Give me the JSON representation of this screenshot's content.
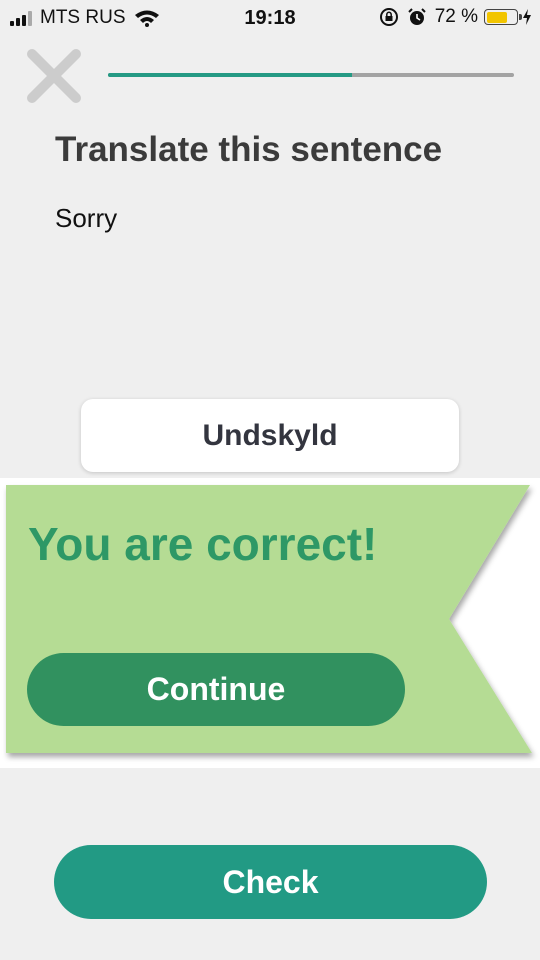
{
  "status_bar": {
    "carrier": "MTS RUS",
    "time": "19:18",
    "battery_percent": "72 %",
    "battery_level": 0.72,
    "icons": [
      "signal-icon",
      "wifi-icon",
      "rotation-lock-icon",
      "alarm-icon",
      "battery-icon",
      "charging-icon"
    ]
  },
  "header": {
    "close_icon": "close-icon",
    "progress": 0.6
  },
  "exercise": {
    "title": "Translate this sentence",
    "source_sentence": "Sorry",
    "answer": "Undskyld"
  },
  "feedback": {
    "message": "You are correct!",
    "continue_label": "Continue"
  },
  "footer": {
    "check_label": "Check"
  },
  "colors": {
    "accent": "#229a84",
    "banner_bg": "#b5dc94",
    "success_text": "#2e9866",
    "continue_bg": "#31915f",
    "close_icon": "#cccccc"
  }
}
